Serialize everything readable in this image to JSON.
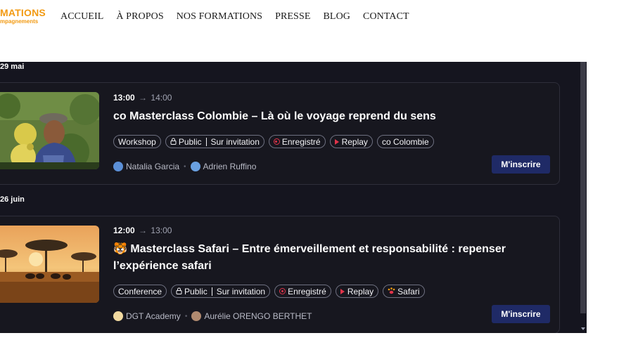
{
  "header": {
    "logo_main": "MATIONS",
    "logo_sub": "mpagnements",
    "nav": [
      "ACCUEIL",
      "À PROPOS",
      "NOS FORMATIONS",
      "PRESSE",
      "BLOG",
      "CONTACT"
    ]
  },
  "events": [
    {
      "date": "29 mai",
      "start": "13:00",
      "arrow": "→",
      "end": "14:00",
      "title": "co Masterclass Colombie – Là où le voyage reprend du sens",
      "tags": {
        "type": "Workshop",
        "access_public": "Public",
        "access_invite": "Sur invitation",
        "recorded": "Enregistré",
        "replay": "Replay",
        "destination": "co Colombie"
      },
      "people": [
        "Natalia Garcia",
        "Adrien Ruffino"
      ],
      "cta": "M'inscrire"
    },
    {
      "date": "26 juin",
      "start": "12:00",
      "arrow": "→",
      "end": "13:00",
      "title": "🐯 Masterclass Safari – Entre émerveillement et responsabilité : repenser l’expérience safari",
      "tags": {
        "type": "Conference",
        "access_public": "Public",
        "access_invite": "Sur invitation",
        "recorded": "Enregistré",
        "replay": "Replay",
        "destination": "Safari"
      },
      "people": [
        "DGT Academy",
        "Aurélie ORENGO BERTHET"
      ],
      "cta": "M'inscrire"
    }
  ],
  "colors": {
    "brand_orange": "#f29a12",
    "panel_bg": "#15151f",
    "cta_bg": "#1f2a66",
    "record_red": "#e0344a"
  },
  "icons": [
    "lock-icon",
    "record-icon",
    "play-icon",
    "paw-icon",
    "avatar-icon"
  ]
}
